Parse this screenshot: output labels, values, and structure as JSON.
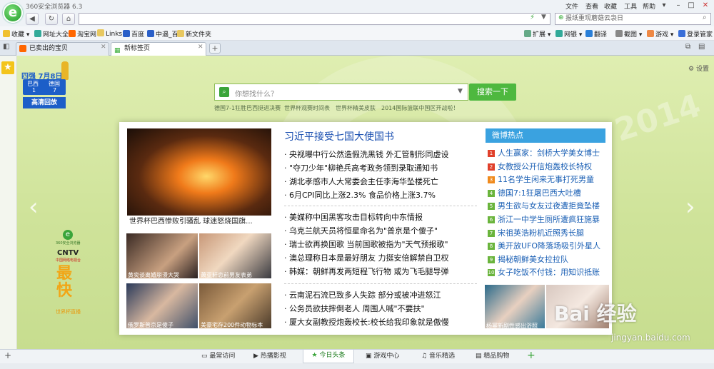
{
  "window": {
    "title": "360安全浏览器 6.3",
    "menu": [
      "文件",
      "查看",
      "收藏",
      "工具",
      "帮助"
    ]
  },
  "address": {
    "url": "",
    "search_placeholder": "报纸重现蘑菇云袅日"
  },
  "favorites": [
    "收藏",
    "网址大全",
    "淘宝网",
    "Links",
    "百度",
    "中遇_百",
    "新文件夹"
  ],
  "toolbar_right": [
    "扩展",
    "网银",
    "翻译",
    "截图",
    "游戏",
    "登录管家"
  ],
  "tabs": [
    {
      "label": "已卖出的宝贝"
    },
    {
      "label": "新标签页"
    }
  ],
  "page": {
    "settings": "设置",
    "promo": {
      "header": "四强 7月8日",
      "team1": "巴西",
      "team1_score": "1",
      "team2": "德国",
      "team2_score": "7",
      "button": "高清回放"
    },
    "search": {
      "placeholder": "你想找什么？",
      "button": "搜索一下"
    },
    "hints": [
      "德国7-1狂胜巴西挺进决赛",
      "世界杯观赛时间表",
      "世界杯精美皮肤",
      "2014国际篮联中国区开战啦！"
    ],
    "side_promo": {
      "brand1": "360安全浏览器",
      "brand2": "CNTV",
      "brand3": "中国网络电视台",
      "big": "最快",
      "sub": "世界杯直播"
    },
    "main_photo_caption": "世界杯巴西惨败引骚乱 球迷怒烧国旗...",
    "thumbs": [
      "黄奕谈离婚崩溃大哭",
      "萧亚轩恋前男友表弟",
      "俄罗斯普京是傻子",
      "美豪宅存200件动物标本"
    ],
    "headline": "习近平接受七国大使国书",
    "news_group1": [
      "央视曝中行公然造假洗黑钱 外汇管制形同虚设",
      "\"夺刀少年\"柳艳兵高考政务领到录取通知书",
      "湖北孝感市人大常委会主任李海华坠楼死亡",
      "6月CPI同比上涨2.3% 食品价格上涨3.7%"
    ],
    "news_group2": [
      "美媒称中国黑客攻击目标转向中东情报",
      "乌克兰航天员将恒星命名为\"普京是个傻子\"",
      "瑞士欲再换国歌 当前国歌被指为\"天气预报歌\"",
      "澳总理称日本是最好朋友 力挺安倍解禁自卫权",
      "韩媒：朝鲜再发两短程飞行物 或为飞毛腿导弹"
    ],
    "news_group3": [
      "云南泥石流已致多人失踪 部分或被冲进怒江",
      "公务员欲扶摔倒老人 周围人喊\"不要扶\"",
      "厦大女副教授炮轰校长:校长给我印象就是傲慢"
    ],
    "weibo": {
      "title": "微博热点",
      "items": [
        "人生赢家：剑桥大学美女博士",
        "女教授公开信炮轰校长特权",
        "11名学生闲来无事打死男童",
        "德国7:1狂屠巴西大吐槽",
        "男生欲与女友过夜遭拒竟坠楼",
        "浙江一中学生厕所遭疯狂施暴",
        "宋祖英浩粉机近照秀长腿",
        "美开放UFO降落场吸引外星人",
        "揭秘朝鲜美女拉拉队",
        "女子吃饭不付钱：用知识抵账"
      ],
      "num_colors": [
        "#e0402b",
        "#e0402b",
        "#f08a1c",
        "#6ab43c",
        "#6ab43c",
        "#6ab43c",
        "#6ab43c",
        "#6ab43c",
        "#6ab43c",
        "#6ab43c"
      ]
    },
    "weibo_photo_caption": "杨幂新剧性感出浴照"
  },
  "bottom_tabs": [
    "最常访问",
    "热播影视",
    "今日头条",
    "游戏中心",
    "音乐精选",
    "精品购物"
  ],
  "watermark": {
    "text": "Bai 经验",
    "url": "jingyan.baidu.com"
  }
}
